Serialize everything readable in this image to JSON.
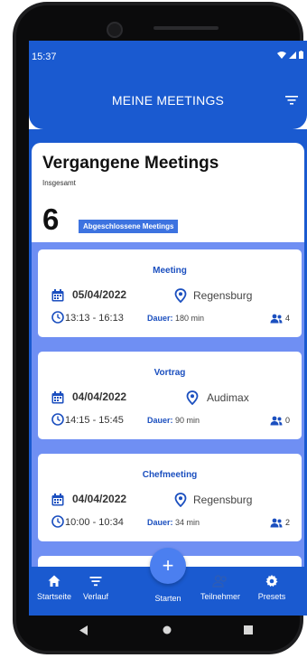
{
  "status_bar": {
    "time": "15:37"
  },
  "header": {
    "title": "MEINE MEETINGS"
  },
  "summary": {
    "title": "Vergangene Meetings",
    "subtitle": "Insgesamt",
    "count": "6",
    "badge": "Abgeschlossene Meetings"
  },
  "meetings": [
    {
      "title": "Meeting",
      "date": "05/04/2022",
      "place": "Regensburg",
      "time": "13:13 - 16:13",
      "dauer_label": "Dauer:",
      "dauer": "180 min",
      "participants": "4"
    },
    {
      "title": "Vortrag",
      "date": "04/04/2022",
      "place": "Audimax",
      "time": "14:15 - 15:45",
      "dauer_label": "Dauer:",
      "dauer": "90 min",
      "participants": "0"
    },
    {
      "title": "Chefmeeting",
      "date": "04/04/2022",
      "place": "Regensburg",
      "time": "10:00 - 10:34",
      "dauer_label": "Dauer:",
      "dauer": "34 min",
      "participants": "2"
    }
  ],
  "nav": {
    "items": [
      {
        "label": "Startseite",
        "icon": "home-icon"
      },
      {
        "label": "Verlauf",
        "icon": "filter-list-icon"
      },
      {
        "label": "Starten",
        "icon": "add-icon"
      },
      {
        "label": "Teilnehmer",
        "icon": "people-icon"
      },
      {
        "label": "Presets",
        "icon": "gear-icon"
      }
    ],
    "fab": "+"
  },
  "colors": {
    "primary": "#1a5ad0",
    "list_bg": "#6f8ff3",
    "accent_text": "#1b4fbf",
    "badge": "#3d73e0"
  }
}
